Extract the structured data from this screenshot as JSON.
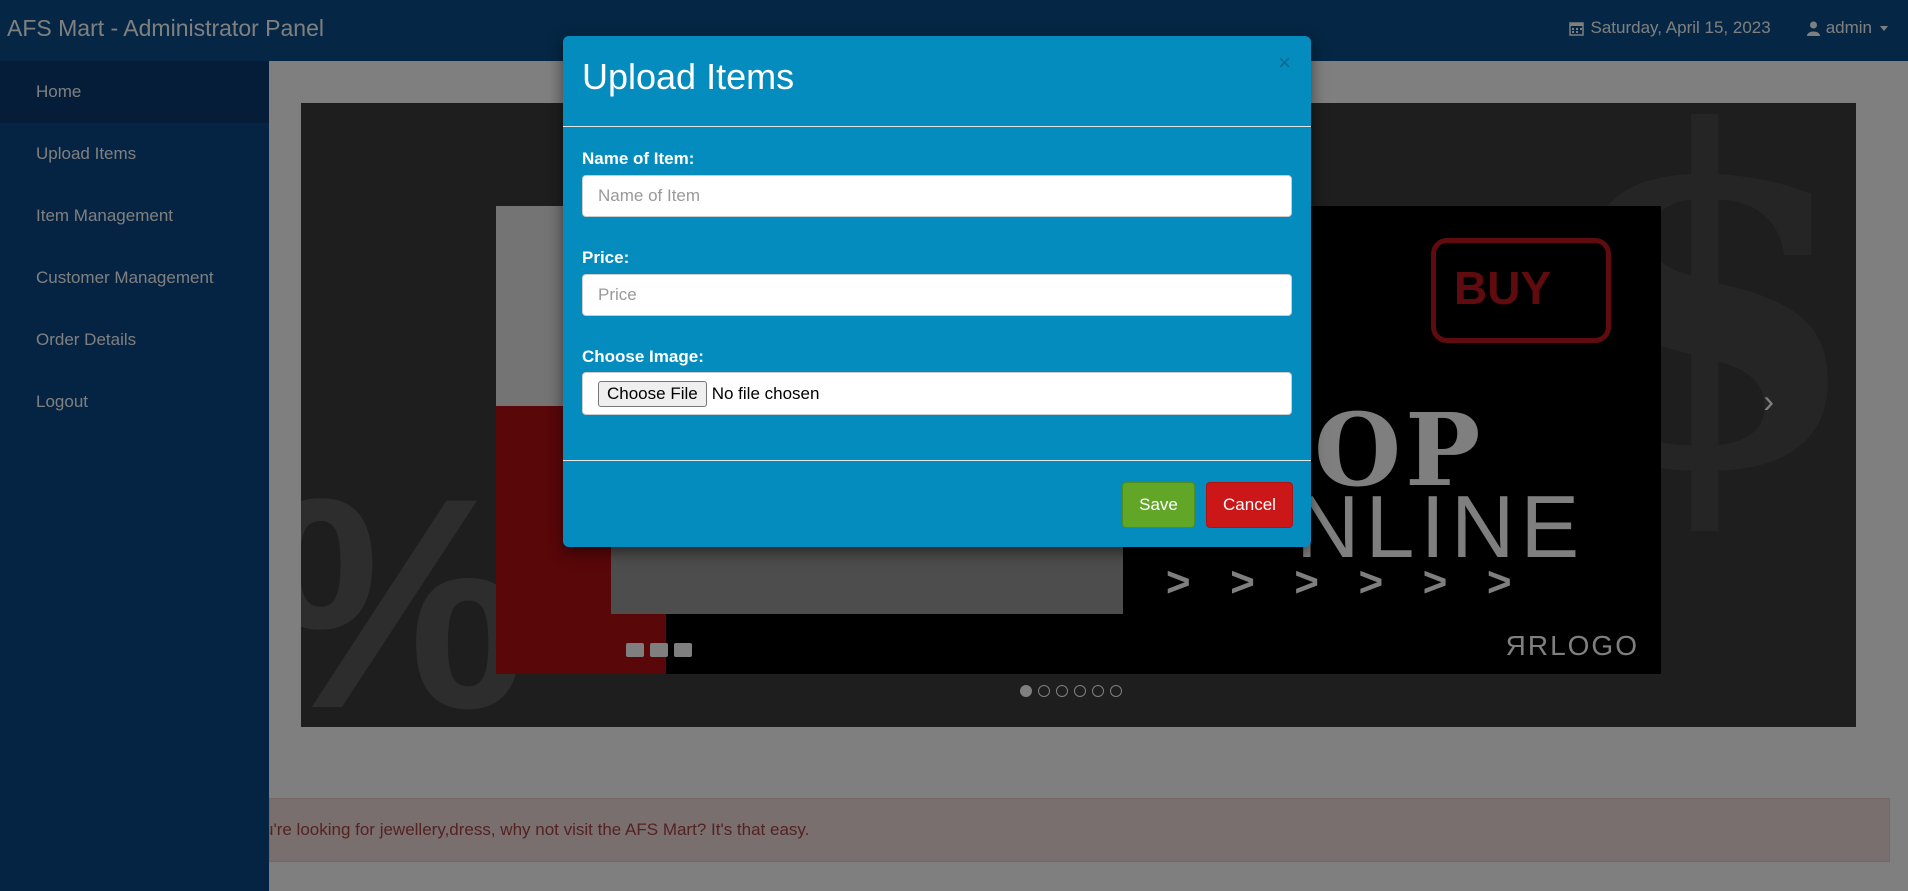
{
  "app": {
    "title": "AFS Mart - Administrator Panel"
  },
  "header": {
    "date": "Saturday, April 15, 2023",
    "user": "admin"
  },
  "sidebar": {
    "items": [
      {
        "label": "Home"
      },
      {
        "label": "Upload Items"
      },
      {
        "label": "Item Management"
      },
      {
        "label": "Customer Management"
      },
      {
        "label": "Order Details"
      },
      {
        "label": "Logout"
      }
    ]
  },
  "carousel": {
    "slide": {
      "buy": "BUY",
      "shop": "OP",
      "online": "NLINE",
      "arrows": "> > > > > >",
      "logo": "ЯRLOGO"
    },
    "next": "›",
    "dots_count": 6,
    "active_dot": 1
  },
  "marquee": {
    "text": "u're looking for jewellery,dress, why not visit the AFS Mart? It's that easy."
  },
  "modal": {
    "title": "Upload Items",
    "close": "×",
    "name_label": "Name of Item:",
    "name_placeholder": "Name of Item",
    "price_label": "Price:",
    "price_placeholder": "Price",
    "image_label": "Choose Image:",
    "file_button": "Choose File",
    "file_status": "No file chosen",
    "save": "Save",
    "cancel": "Cancel"
  },
  "icons": {
    "date": "calendar-icon",
    "user": "user-icon",
    "dropdown": "caret-down-icon"
  },
  "colors": {
    "topbar": "#0b4f8a",
    "sidebar": "#0a4785",
    "modal": "#058cbf",
    "save": "#62a628",
    "cancel": "#cc1719"
  }
}
